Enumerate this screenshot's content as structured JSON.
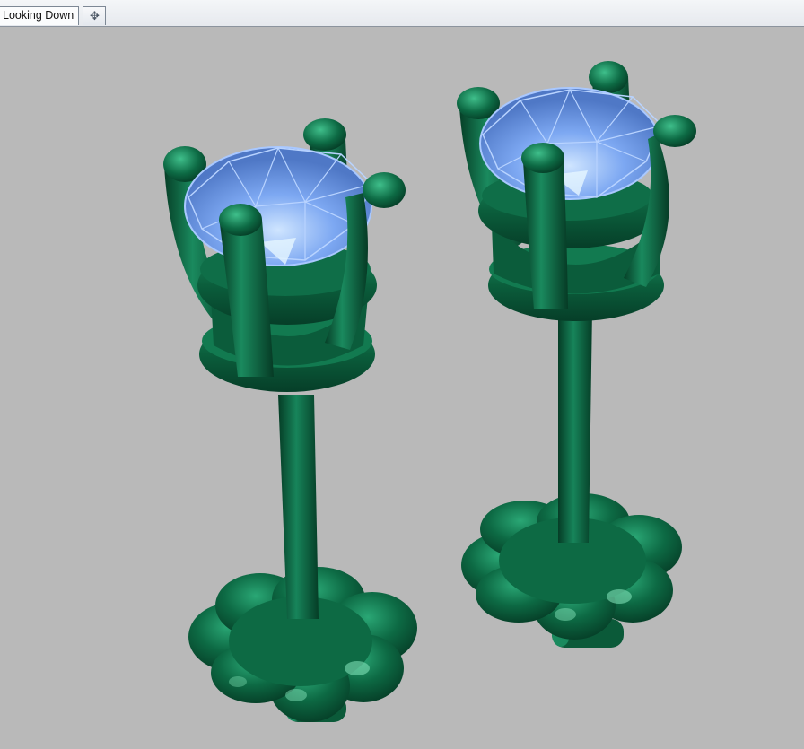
{
  "tabs": [
    {
      "label": "Looking Down",
      "active": true
    }
  ],
  "add_tab_icon": "plus-icon",
  "viewport": {
    "background": "#b9b9b9",
    "model_color": "#0e6b45",
    "gem_color": "#7da8f2"
  }
}
